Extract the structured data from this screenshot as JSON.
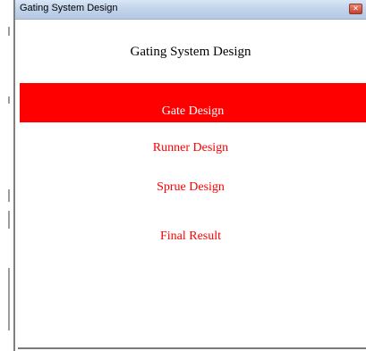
{
  "window": {
    "title": "Gating System Design",
    "close_icon": "close-icon"
  },
  "main": {
    "heading": "Gating System Design",
    "menu": [
      {
        "label": "Gate Design",
        "active": true
      },
      {
        "label": "Runner Design",
        "active": false
      },
      {
        "label": "Sprue Design",
        "active": false
      },
      {
        "label": "Final Result",
        "active": false
      }
    ]
  },
  "colors": {
    "accent": "#ff0000",
    "active_text": "#ffffff",
    "titlebar": "#c1d3ea"
  }
}
